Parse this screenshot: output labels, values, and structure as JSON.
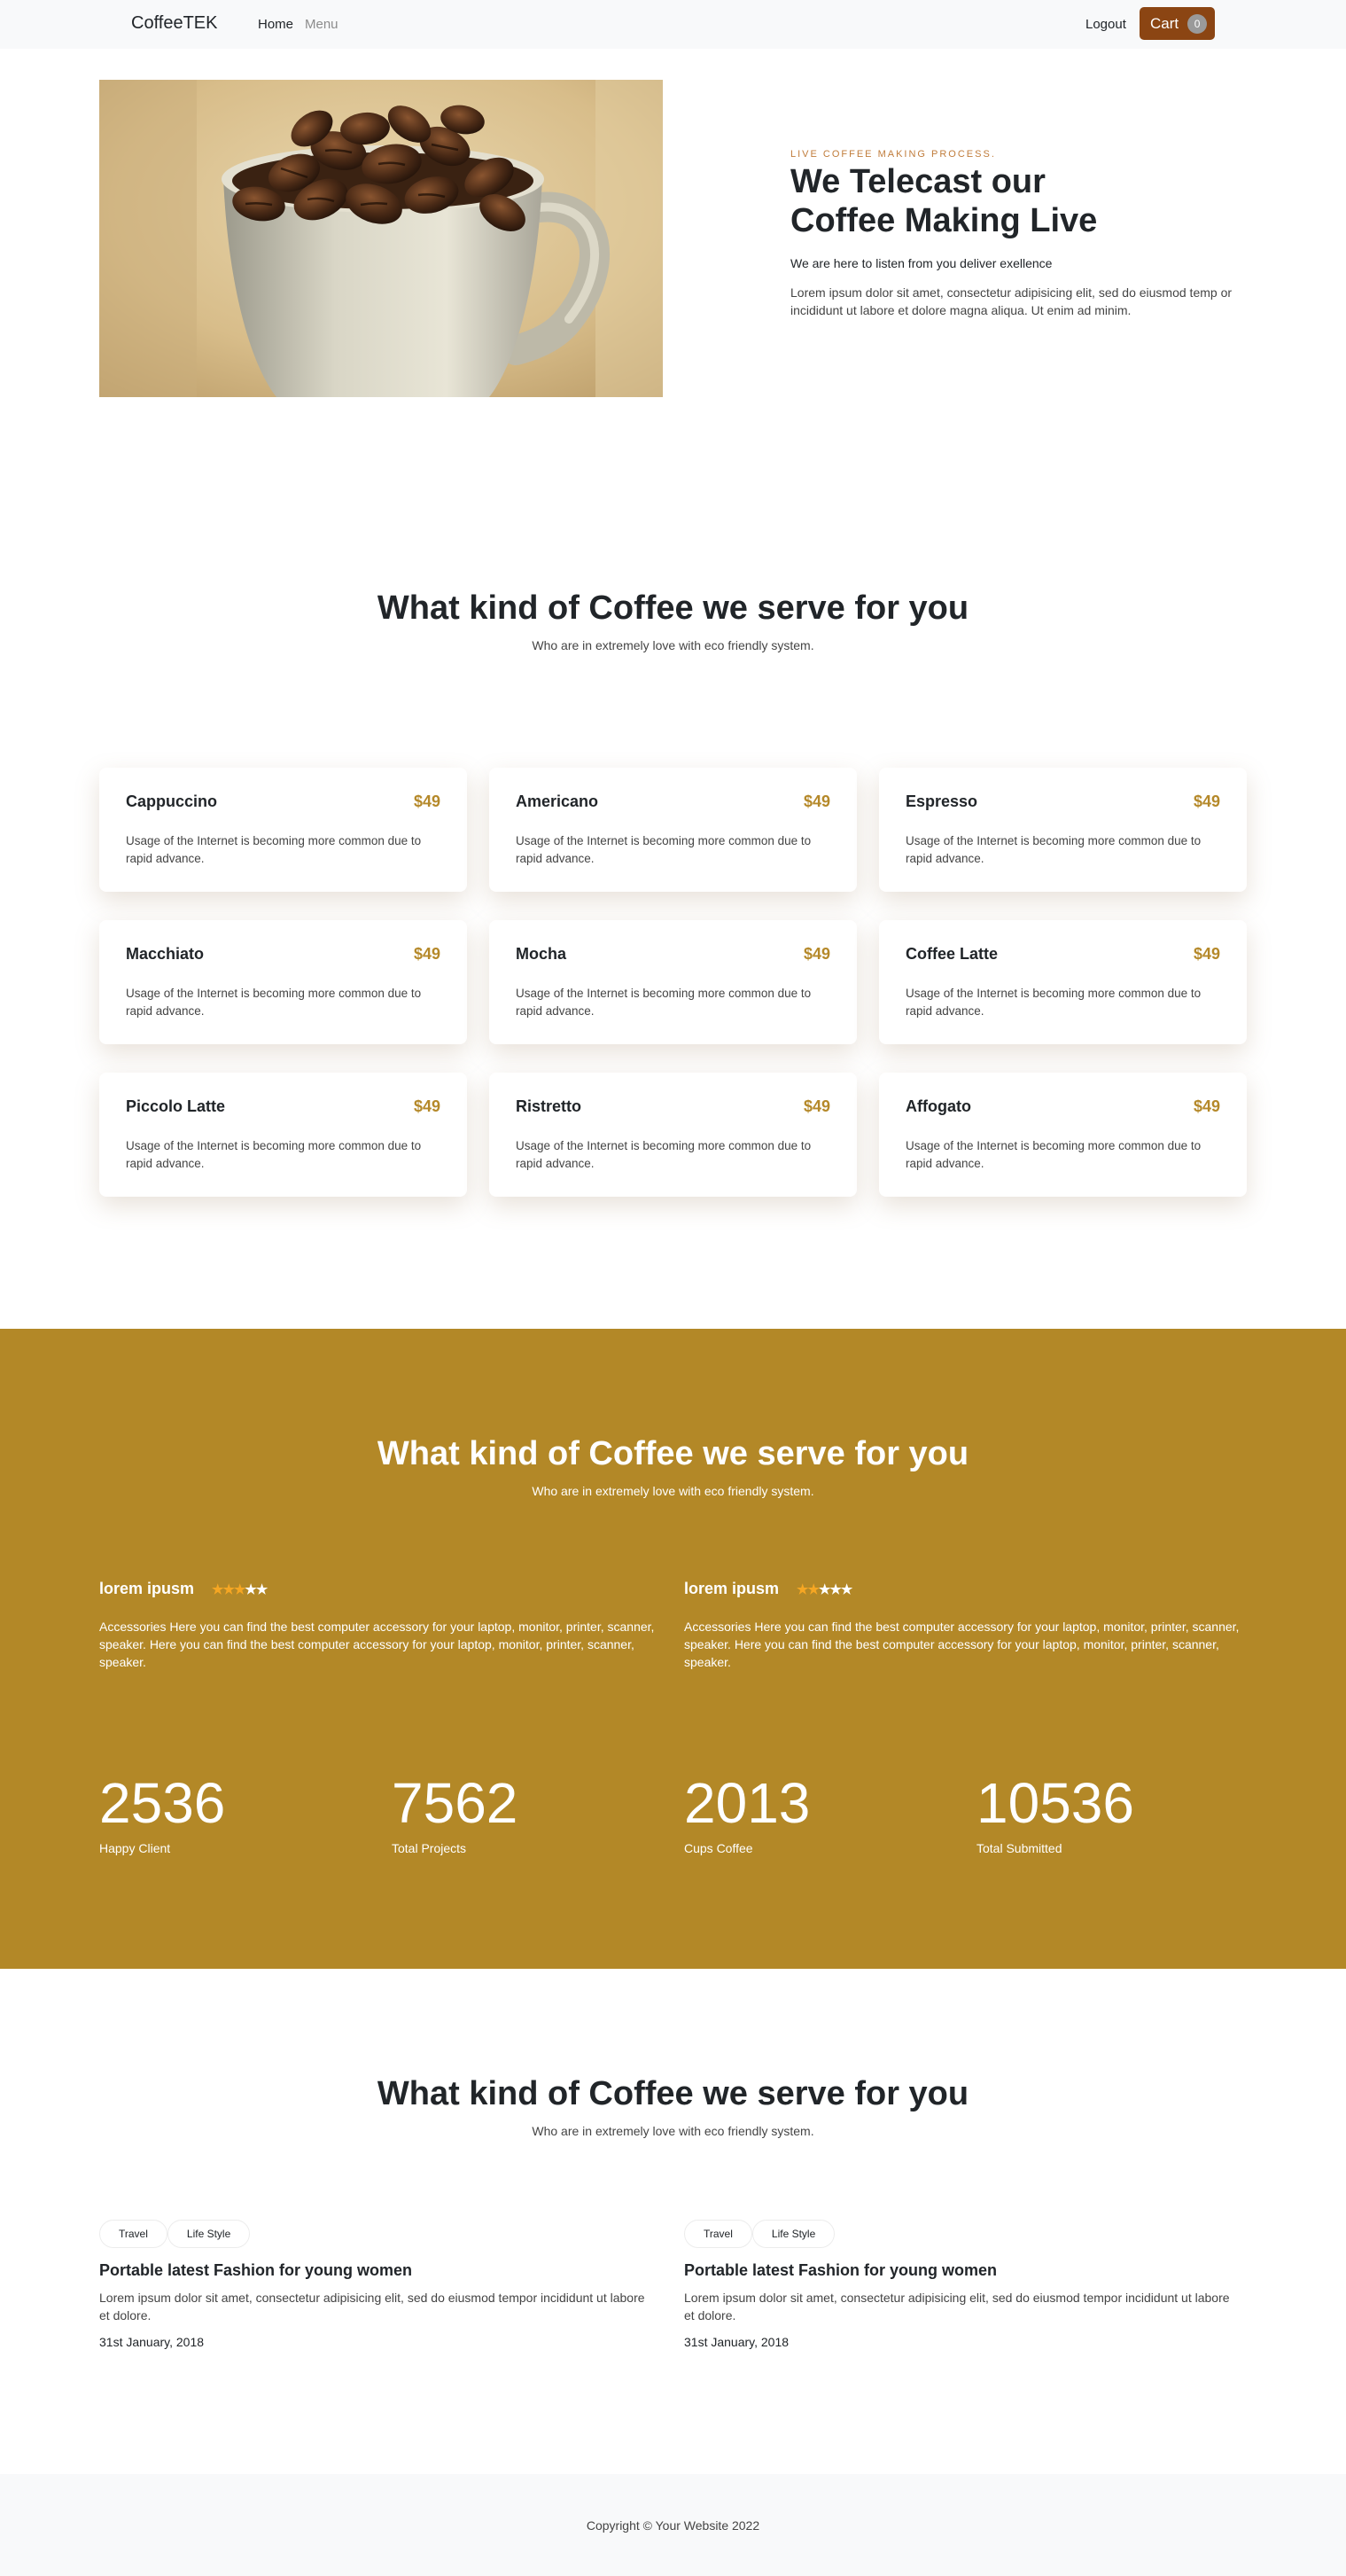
{
  "nav": {
    "brand": "CoffeeTEK",
    "home": "Home",
    "menu": "Menu",
    "logout": "Logout",
    "cart_label": "Cart",
    "cart_count": "0"
  },
  "hero": {
    "eyebrow": "LIVE COFFEE MAKING PROCESS.",
    "title_line1": "We Telecast our",
    "title_line2": "Coffee Making Live",
    "lead": "We are here to listen from you deliver exellence",
    "text": "Lorem ipsum dolor sit amet, consectetur adipisicing elit, sed do eiusmod temp or incididunt ut labore et dolore magna aliqua. Ut enim ad minim."
  },
  "menu_section": {
    "title": "What kind of Coffee we serve for you",
    "subtitle": "Who are in extremely love with eco friendly system.",
    "items": [
      {
        "name": "Cappuccino",
        "price": "$49",
        "desc": "Usage of the Internet is becoming more common due to rapid advance."
      },
      {
        "name": "Americano",
        "price": "$49",
        "desc": "Usage of the Internet is becoming more common due to rapid advance."
      },
      {
        "name": "Espresso",
        "price": "$49",
        "desc": "Usage of the Internet is becoming more common due to rapid advance."
      },
      {
        "name": "Macchiato",
        "price": "$49",
        "desc": "Usage of the Internet is becoming more common due to rapid advance."
      },
      {
        "name": "Mocha",
        "price": "$49",
        "desc": "Usage of the Internet is becoming more common due to rapid advance."
      },
      {
        "name": "Coffee Latte",
        "price": "$49",
        "desc": "Usage of the Internet is becoming more common due to rapid advance."
      },
      {
        "name": "Piccolo Latte",
        "price": "$49",
        "desc": "Usage of the Internet is becoming more common due to rapid advance."
      },
      {
        "name": "Ristretto",
        "price": "$49",
        "desc": "Usage of the Internet is becoming more common due to rapid advance."
      },
      {
        "name": "Affogato",
        "price": "$49",
        "desc": "Usage of the Internet is becoming more common due to rapid advance."
      }
    ]
  },
  "reviews_section": {
    "title": "What kind of Coffee we serve for you",
    "subtitle": "Who are in extremely love with eco friendly system.",
    "reviews": [
      {
        "title": "lorem ipusm",
        "rating": 3,
        "max": 5,
        "text": "Accessories Here you can find the best computer accessory for your laptop, monitor, printer, scanner, speaker. Here you can find the best computer accessory for your laptop, monitor, printer, scanner, speaker."
      },
      {
        "title": "lorem ipusm",
        "rating": 2,
        "max": 5,
        "text": "Accessories Here you can find the best computer accessory for your laptop, monitor, printer, scanner, speaker. Here you can find the best computer accessory for your laptop, monitor, printer, scanner, speaker."
      }
    ],
    "stats": [
      {
        "value": "2536",
        "label": "Happy Client"
      },
      {
        "value": "7562",
        "label": "Total Projects"
      },
      {
        "value": "2013",
        "label": "Cups Coffee"
      },
      {
        "value": "10536",
        "label": "Total Submitted"
      }
    ]
  },
  "blog_section": {
    "title": "What kind of Coffee we serve for you",
    "subtitle": "Who are in extremely love with eco friendly system.",
    "posts": [
      {
        "tags": [
          "Travel",
          "Life Style"
        ],
        "title": "Portable latest Fashion for young women",
        "text": "Lorem ipsum dolor sit amet, consectetur adipisicing elit, sed do eiusmod tempor incididunt ut labore et dolore.",
        "date": "31st January, 2018"
      },
      {
        "tags": [
          "Travel",
          "Life Style"
        ],
        "title": "Portable latest Fashion for young women",
        "text": "Lorem ipsum dolor sit amet, consectetur adipisicing elit, sed do eiusmod tempor incididunt ut labore et dolore.",
        "date": "31st January, 2018"
      }
    ]
  },
  "footer": {
    "text": "Copyright © Your Website 2022"
  },
  "colors": {
    "brand_gold": "#b38827",
    "price_gold": "#b5892a",
    "cart_brown": "#8b4513",
    "star_active": "#f5a623"
  }
}
